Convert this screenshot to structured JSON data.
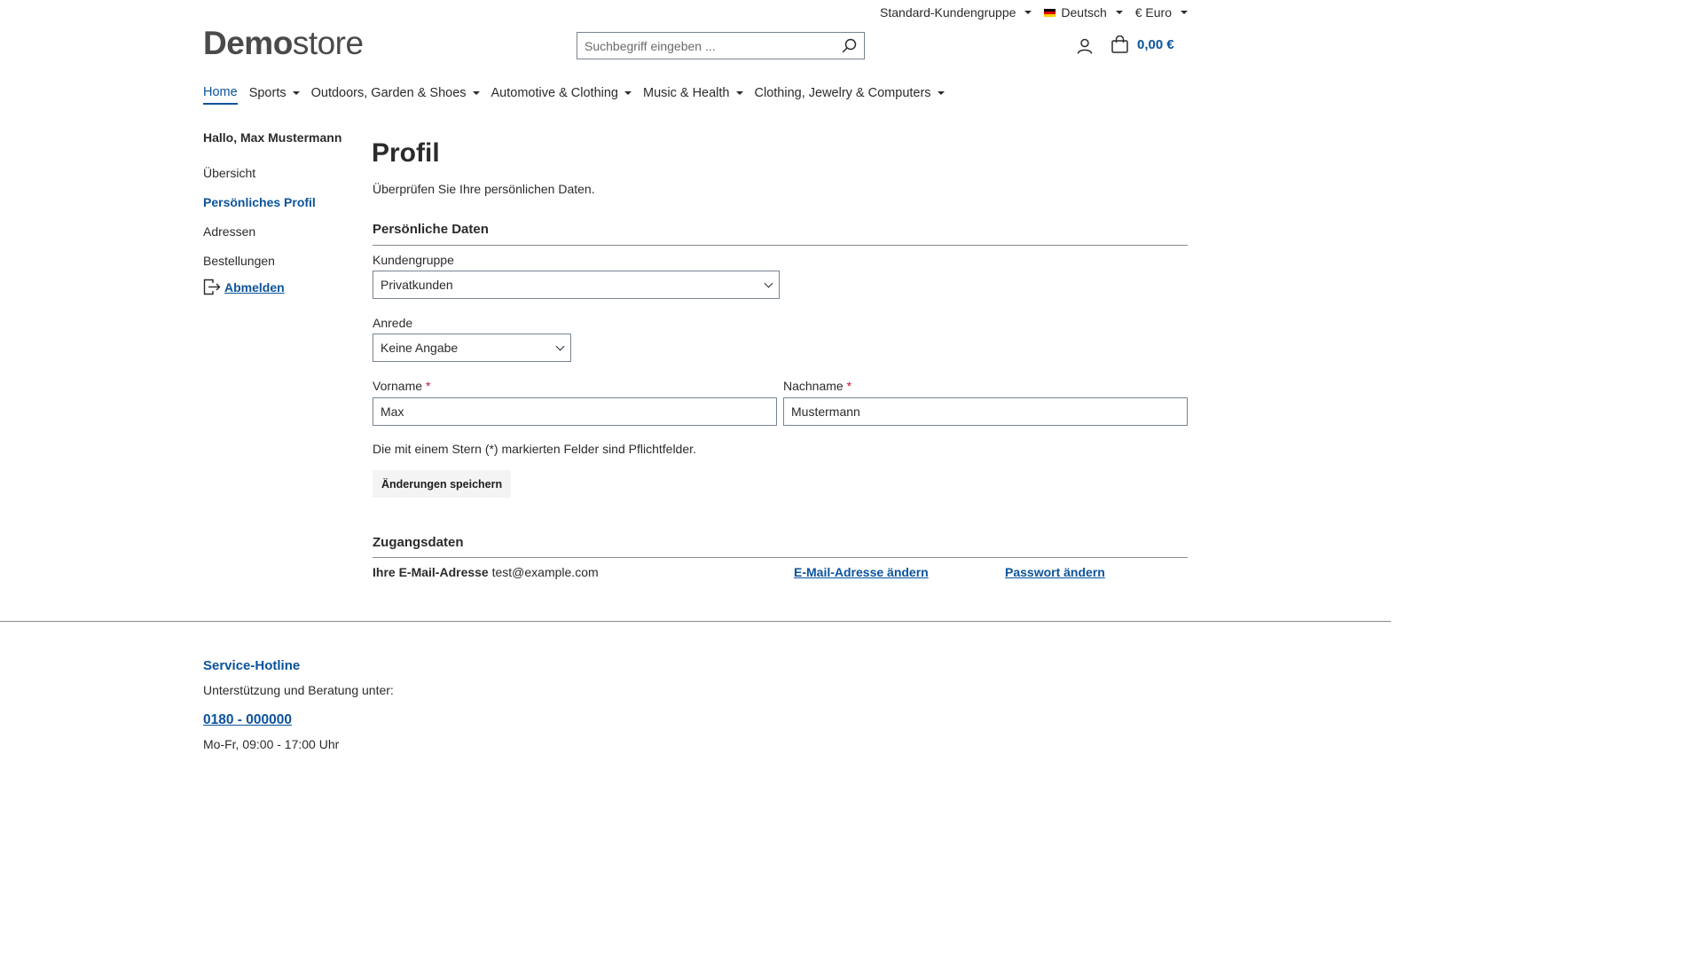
{
  "topbar": {
    "customer_group": "Standard-Kundengruppe",
    "language": "Deutsch",
    "currency": "€ Euro"
  },
  "logo": {
    "bold": "Demo",
    "light": "store"
  },
  "search": {
    "placeholder": "Suchbegriff eingeben ..."
  },
  "cart": {
    "total": "0,00 €"
  },
  "nav": {
    "items": [
      {
        "label": "Home"
      },
      {
        "label": "Sports"
      },
      {
        "label": "Outdoors, Garden & Shoes"
      },
      {
        "label": "Automotive & Clothing"
      },
      {
        "label": "Music & Health"
      },
      {
        "label": "Clothing, Jewelry & Computers"
      }
    ]
  },
  "sidebar": {
    "greeting": "Hallo, Max Mustermann",
    "items": [
      {
        "label": "Übersicht"
      },
      {
        "label": "Persönliches Profil"
      },
      {
        "label": "Adressen"
      },
      {
        "label": "Bestellungen"
      }
    ],
    "logout": "Abmelden"
  },
  "main": {
    "title": "Profil",
    "subtitle": "Überprüfen Sie Ihre persönlichen Daten.",
    "personal_section": "Persönliche Daten",
    "customer_group_label": "Kundengruppe",
    "customer_group_value": "Privatkunden",
    "salutation_label": "Anrede",
    "salutation_value": "Keine Angabe",
    "firstname_label": "Vorname",
    "firstname_value": "Max",
    "lastname_label": "Nachname",
    "lastname_value": "Mustermann",
    "required_marker": "*",
    "required_note": "Die mit einem Stern (*) markierten Felder sind Pflichtfelder.",
    "save_label": "Änderungen speichern",
    "access_section": "Zugangsdaten",
    "email_label": "Ihre E-Mail-Adresse",
    "email_value": "test@example.com",
    "change_email": "E-Mail-Adresse ändern",
    "change_password": "Passwort ändern"
  },
  "footer": {
    "hotline_title": "Service-Hotline",
    "hotline_sub": "Unterstützung und Beratung unter:",
    "phone": "0180 - 000000",
    "hours": "Mo-Fr, 09:00 - 17:00 Uhr"
  },
  "colors": {
    "accent": "#0b539b",
    "required": "#c8102e",
    "text": "#2b2b2b"
  }
}
